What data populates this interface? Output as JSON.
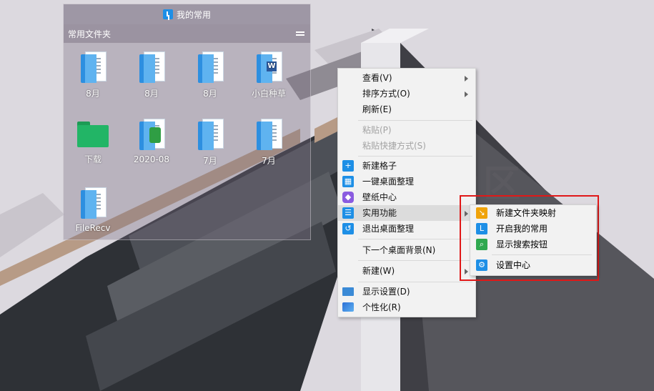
{
  "fence": {
    "title": "我的常用",
    "header": "常用文件夹",
    "items": [
      {
        "label": "8月",
        "icon": "document-folder-icon"
      },
      {
        "label": "8月",
        "icon": "document-folder-icon"
      },
      {
        "label": "8月",
        "icon": "document-folder-icon"
      },
      {
        "label": "小白种草",
        "icon": "word-document-icon"
      },
      {
        "label": "下载",
        "icon": "green-folder-icon"
      },
      {
        "label": "2020-08",
        "icon": "image-folder-icon"
      },
      {
        "label": "7月",
        "icon": "document-folder-icon"
      },
      {
        "label": "7月",
        "icon": "document-folder-icon"
      },
      {
        "label": "FileRecv",
        "icon": "document-folder-icon"
      }
    ]
  },
  "context_menu": {
    "items": [
      {
        "label": "查看(V)",
        "submenu": true
      },
      {
        "label": "排序方式(O)",
        "submenu": true
      },
      {
        "label": "刷新(E)"
      },
      {
        "label": "粘贴(P)",
        "disabled": true
      },
      {
        "label": "粘贴快捷方式(S)",
        "disabled": true
      },
      {
        "label": "新建格子",
        "icon": "plus-icon"
      },
      {
        "label": "一键桌面整理",
        "icon": "layout-icon"
      },
      {
        "label": "壁纸中心",
        "icon": "cube-icon"
      },
      {
        "label": "实用功能",
        "icon": "list-icon",
        "submenu": true,
        "active": true
      },
      {
        "label": "退出桌面整理",
        "icon": "undo-icon"
      },
      {
        "label": "下一个桌面背景(N)"
      },
      {
        "label": "新建(W)",
        "submenu": true
      },
      {
        "label": "显示设置(D)",
        "icon": "monitor-icon"
      },
      {
        "label": "个性化(R)",
        "icon": "personalize-icon"
      }
    ]
  },
  "submenu": {
    "items": [
      {
        "label": "新建文件夹映射",
        "icon": "folder-map-icon"
      },
      {
        "label": "开启我的常用",
        "icon": "my-common-icon"
      },
      {
        "label": "显示搜索按钮",
        "icon": "search-icon"
      },
      {
        "label": "设置中心",
        "icon": "gear-icon"
      }
    ]
  },
  "colors": {
    "accent_blue": "#1e8fe6",
    "highlight_red": "#e01818",
    "menu_bg": "#f2f2f2"
  }
}
